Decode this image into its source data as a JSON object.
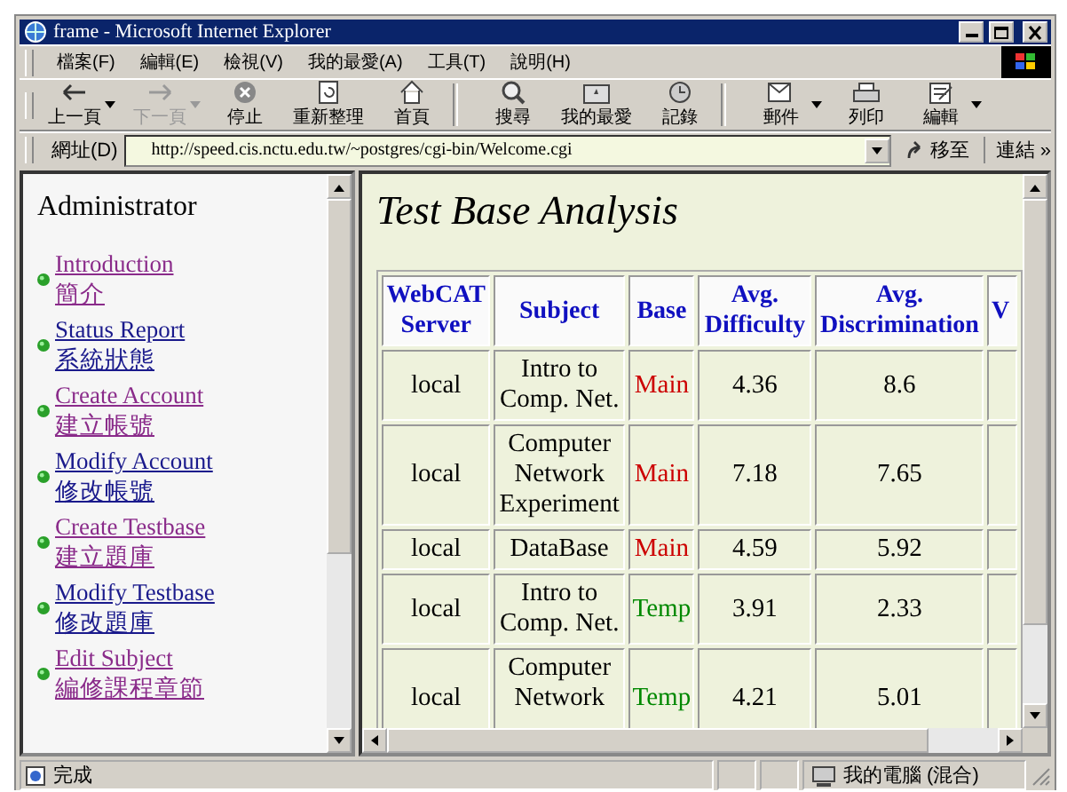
{
  "window": {
    "title": "frame - Microsoft Internet Explorer"
  },
  "menu": [
    "檔案(F)",
    "編輯(E)",
    "檢視(V)",
    "我的最愛(A)",
    "工具(T)",
    "說明(H)"
  ],
  "toolbar": [
    {
      "kind": "back",
      "label": "上一頁",
      "disabled": false,
      "dropdown": true
    },
    {
      "kind": "forward",
      "label": "下一頁",
      "disabled": true,
      "dropdown": true
    },
    {
      "kind": "stop",
      "label": "停止",
      "disabled": false,
      "dropdown": false
    },
    {
      "kind": "refresh",
      "label": "重新整理",
      "disabled": false,
      "dropdown": false
    },
    {
      "kind": "home",
      "label": "首頁",
      "disabled": false,
      "dropdown": false,
      "sep_after": true
    },
    {
      "kind": "search",
      "label": "搜尋",
      "disabled": false,
      "dropdown": false
    },
    {
      "kind": "favorites",
      "label": "我的最愛",
      "disabled": false,
      "dropdown": false
    },
    {
      "kind": "history",
      "label": "記錄",
      "disabled": false,
      "dropdown": false,
      "sep_after": true
    },
    {
      "kind": "mail",
      "label": "郵件",
      "disabled": false,
      "dropdown": true
    },
    {
      "kind": "print",
      "label": "列印",
      "disabled": false,
      "dropdown": false
    },
    {
      "kind": "edit",
      "label": "編輯",
      "disabled": false,
      "dropdown": true
    }
  ],
  "address": {
    "label": "網址(D)",
    "value": "http://speed.cis.nctu.edu.tw/~postgres/cgi-bin/Welcome.cgi",
    "go": "移至",
    "links": "連結 »"
  },
  "sidebar": {
    "title": "Administrator",
    "items": [
      {
        "en": "Introduction",
        "zh": "簡介",
        "visited": true
      },
      {
        "en": "Status Report",
        "zh": "系統狀態",
        "visited": false
      },
      {
        "en": "Create Account",
        "zh": "建立帳號",
        "visited": true
      },
      {
        "en": "Modify Account",
        "zh": "修改帳號",
        "visited": false
      },
      {
        "en": "Create Testbase",
        "zh": "建立題庫",
        "visited": true
      },
      {
        "en": "Modify Testbase",
        "zh": "修改題庫",
        "visited": false
      },
      {
        "en": "Edit Subject",
        "zh": "編修課程章節",
        "visited": true
      }
    ]
  },
  "main": {
    "title": "Test Base Analysis",
    "table": {
      "columns": [
        [
          "WebCAT",
          "Server"
        ],
        [
          "Subject"
        ],
        [
          "Base"
        ],
        [
          "Avg.",
          "Difficulty"
        ],
        [
          "Avg.",
          "Discrimination"
        ],
        [
          "V"
        ]
      ],
      "rows": [
        {
          "server": "local",
          "subject": [
            "Intro to",
            "Comp. Net."
          ],
          "base": {
            "text": "Main",
            "color": "#cc0000"
          },
          "difficulty": "4.36",
          "discrimination": "8.6"
        },
        {
          "server": "local",
          "subject": [
            "Computer",
            "Network",
            "Experiment"
          ],
          "base": {
            "text": "Main",
            "color": "#cc0000"
          },
          "difficulty": "7.18",
          "discrimination": "7.65"
        },
        {
          "server": "local",
          "subject": [
            "DataBase"
          ],
          "base": {
            "text": "Main",
            "color": "#cc0000"
          },
          "difficulty": "4.59",
          "discrimination": "5.92"
        },
        {
          "server": "local",
          "subject": [
            "Intro to",
            "Comp. Net."
          ],
          "base": {
            "text": "Temp",
            "color": "#008800"
          },
          "difficulty": "3.91",
          "discrimination": "2.33"
        },
        {
          "server": "local",
          "subject": [
            "Computer",
            "Network"
          ],
          "base": {
            "text": "Temp",
            "color": "#008800"
          },
          "difficulty": "4.21",
          "discrimination": "5.01"
        }
      ]
    }
  },
  "status_bar": {
    "text": "完成",
    "zone": "我的電腦 (混合)"
  }
}
